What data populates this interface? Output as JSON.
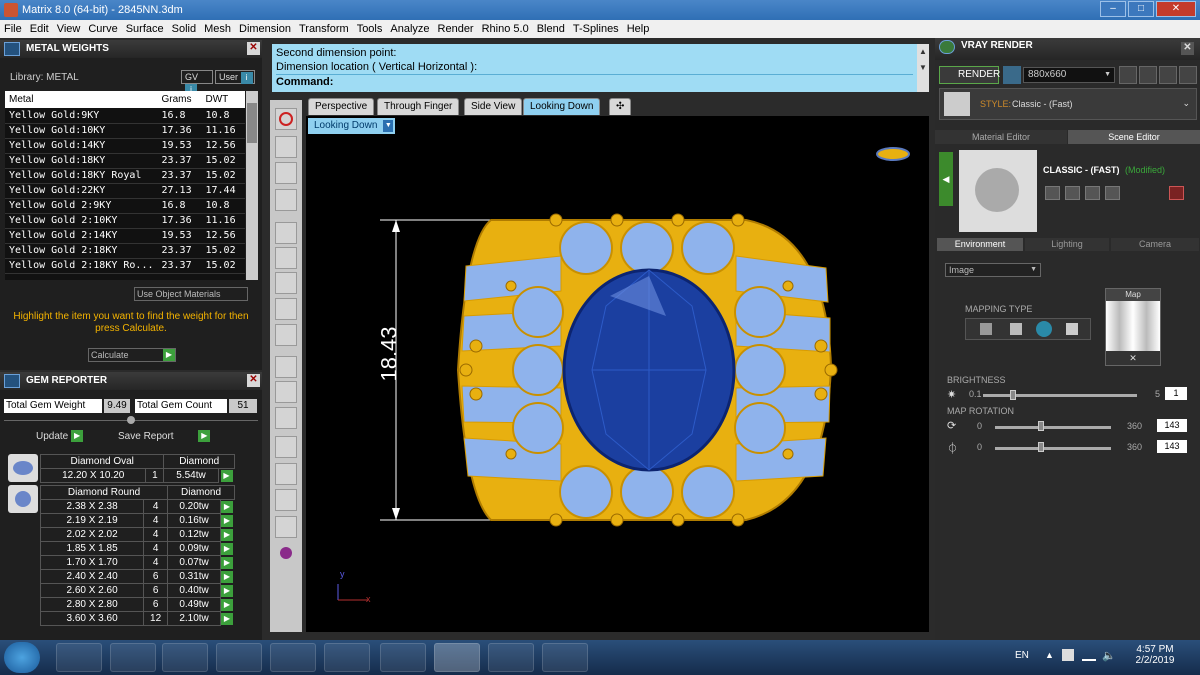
{
  "window": {
    "title": "Matrix 8.0 (64-bit) - 2845NN.3dm"
  },
  "menu": [
    "File",
    "Edit",
    "View",
    "Curve",
    "Surface",
    "Solid",
    "Mesh",
    "Dimension",
    "Transform",
    "Tools",
    "Analyze",
    "Render",
    "Rhino 5.0",
    "Blend",
    "T-Splines",
    "Help"
  ],
  "metal": {
    "title": "METAL WEIGHTS",
    "library": "Library: METAL",
    "gv": "GV",
    "user": "User",
    "headers": [
      "Metal",
      "Grams",
      "DWT"
    ],
    "rows": [
      [
        "Yellow Gold:9KY",
        "16.8",
        "10.8"
      ],
      [
        "Yellow Gold:10KY",
        "17.36",
        "11.16"
      ],
      [
        "Yellow Gold:14KY",
        "19.53",
        "12.56"
      ],
      [
        "Yellow Gold:18KY",
        "23.37",
        "15.02"
      ],
      [
        "Yellow Gold:18KY Royal",
        "23.37",
        "15.02"
      ],
      [
        "Yellow Gold:22KY",
        "27.13",
        "17.44"
      ],
      [
        "Yellow Gold 2:9KY",
        "16.8",
        "10.8"
      ],
      [
        "Yellow Gold 2:10KY",
        "17.36",
        "11.16"
      ],
      [
        "Yellow Gold 2:14KY",
        "19.53",
        "12.56"
      ],
      [
        "Yellow Gold 2:18KY",
        "23.37",
        "15.02"
      ],
      [
        "Yellow Gold 2:18KY Ro...",
        "23.37",
        "15.02"
      ]
    ],
    "use_materials": "Use Object Materials",
    "hint": "Highlight the item you want to find the weight for then press Calculate.",
    "calculate": "Calculate"
  },
  "gem": {
    "title": "GEM REPORTER",
    "total_weight_label": "Total Gem Weight",
    "total_weight": "9.49",
    "total_count_label": "Total Gem Count",
    "total_count": "51",
    "update": "Update",
    "save": "Save Report",
    "oval": {
      "shape": "Diamond Oval",
      "type": "Diamond",
      "size": "12.20 X 10.20",
      "qty": "1",
      "tw": "5.54tw"
    },
    "round_header": {
      "shape": "Diamond Round",
      "type": "Diamond"
    },
    "round_rows": [
      [
        "2.38 X 2.38",
        "4",
        "0.20tw"
      ],
      [
        "2.19 X 2.19",
        "4",
        "0.16tw"
      ],
      [
        "2.02 X 2.02",
        "4",
        "0.12tw"
      ],
      [
        "1.85 X 1.85",
        "4",
        "0.09tw"
      ],
      [
        "1.70 X 1.70",
        "4",
        "0.07tw"
      ],
      [
        "2.40 X 2.40",
        "6",
        "0.31tw"
      ],
      [
        "2.60 X 2.60",
        "6",
        "0.40tw"
      ],
      [
        "2.80 X 2.80",
        "6",
        "0.49tw"
      ],
      [
        "3.60 X 3.60",
        "12",
        "2.10tw"
      ]
    ]
  },
  "command": {
    "line1": "Second dimension point:",
    "line2": "Dimension location ( Vertical  Horizontal ):",
    "prompt": "Command:"
  },
  "viewtabs": [
    "Perspective",
    "Through Finger",
    "Side View",
    "Looking Down"
  ],
  "viewport": {
    "label": "Looking Down",
    "dimension": "18.43",
    "axis_y": "y",
    "axis_x": "x"
  },
  "vray": {
    "title": "VRAY RENDER",
    "render": "RENDER",
    "resolution": "880x660",
    "style_label": "STYLE:",
    "style_value": "Classic - (Fast)",
    "tabs": [
      "Material Editor",
      "Scene Editor"
    ],
    "scene_name": "CLASSIC - (FAST)",
    "modified": "(Modified)",
    "subtabs": [
      "Environment",
      "Lighting",
      "Camera"
    ],
    "env_select": "Image",
    "mapping_type": "MAPPING TYPE",
    "map_label": "Map",
    "brightness_label": "BRIGHTNESS",
    "brightness_min": "0.1",
    "brightness_max": "5",
    "brightness_val": "1",
    "rotation_label": "MAP ROTATION",
    "rot1_min": "0",
    "rot1_max": "360",
    "rot1_val": "143",
    "rot2_min": "0",
    "rot2_max": "360",
    "rot2_val": "143"
  },
  "taskbar": {
    "lang": "EN",
    "time": "4:57 PM",
    "date": "2/2/2019"
  },
  "colors": {
    "gold": "#e8b010",
    "gem_blue": "#8fb3ec",
    "center_stone": "#1b3fa0",
    "title_blue": "#3677bf"
  }
}
